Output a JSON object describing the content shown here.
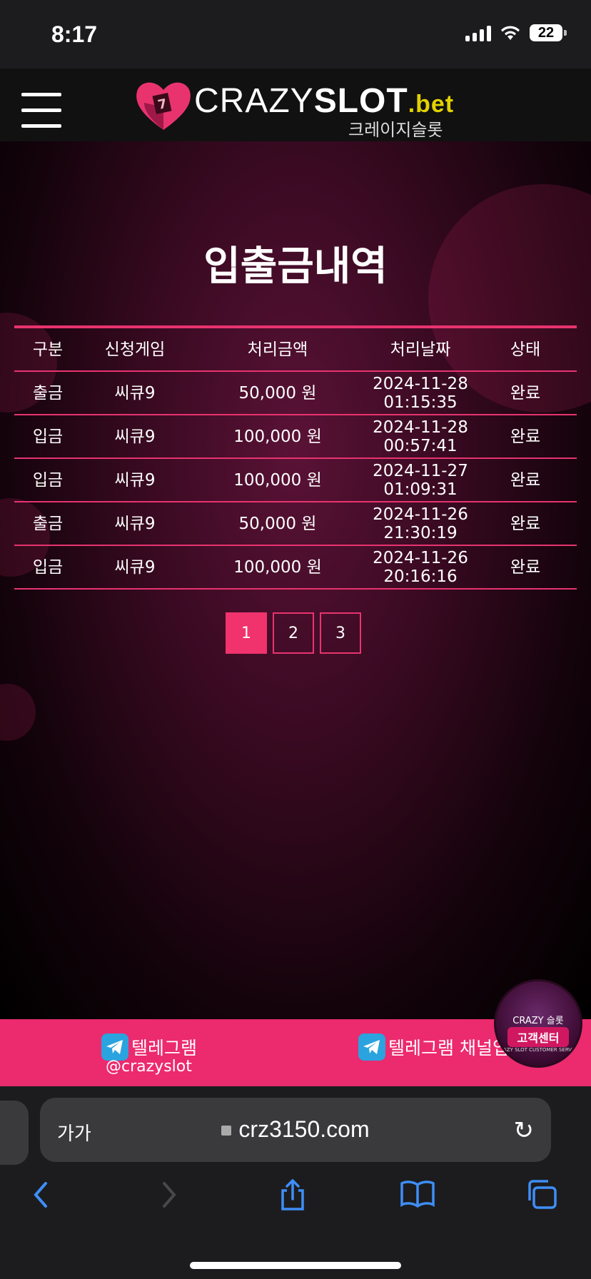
{
  "status_bar": {
    "time": "8:17",
    "battery": "22"
  },
  "header": {
    "logo_crazy": "CRAZY",
    "logo_slot": "SLOT",
    "logo_bet": ".bet",
    "logo_korean": "크레이지슬롯"
  },
  "page": {
    "title": "입출금내역"
  },
  "table": {
    "headers": [
      "구분",
      "신청게임",
      "처리금액",
      "처리날짜",
      "상태"
    ],
    "rows": [
      {
        "type": "출금",
        "game": "씨큐9",
        "amount": "50,000 원",
        "date": "2024-11-28",
        "time": "01:15:35",
        "status": "완료"
      },
      {
        "type": "입금",
        "game": "씨큐9",
        "amount": "100,000 원",
        "date": "2024-11-28",
        "time": "00:57:41",
        "status": "완료"
      },
      {
        "type": "입금",
        "game": "씨큐9",
        "amount": "100,000 원",
        "date": "2024-11-27",
        "time": "01:09:31",
        "status": "완료"
      },
      {
        "type": "출금",
        "game": "씨큐9",
        "amount": "50,000 원",
        "date": "2024-11-26",
        "time": "21:30:19",
        "status": "완료"
      },
      {
        "type": "입금",
        "game": "씨큐9",
        "amount": "100,000 원",
        "date": "2024-11-26",
        "time": "20:16:16",
        "status": "완료"
      }
    ]
  },
  "pagination": {
    "pages": [
      "1",
      "2",
      "3"
    ],
    "current": "1"
  },
  "footer": {
    "telegram_label": "텔레그램",
    "telegram_handle": "@crazyslot",
    "telegram_channel_label": "텔레그램 채널입",
    "cs_badge_top": "CRAZY 슬롯",
    "cs_badge_main": "고객센터",
    "cs_badge_sub": "CRAZY SLOT CUSTOMER SERVICE"
  },
  "browser": {
    "text_size": "가가",
    "url": "crz3150.com"
  },
  "colors": {
    "accent": "#ec2a6e",
    "border": "#e8336f",
    "ios_blue": "#3e8ef7"
  }
}
